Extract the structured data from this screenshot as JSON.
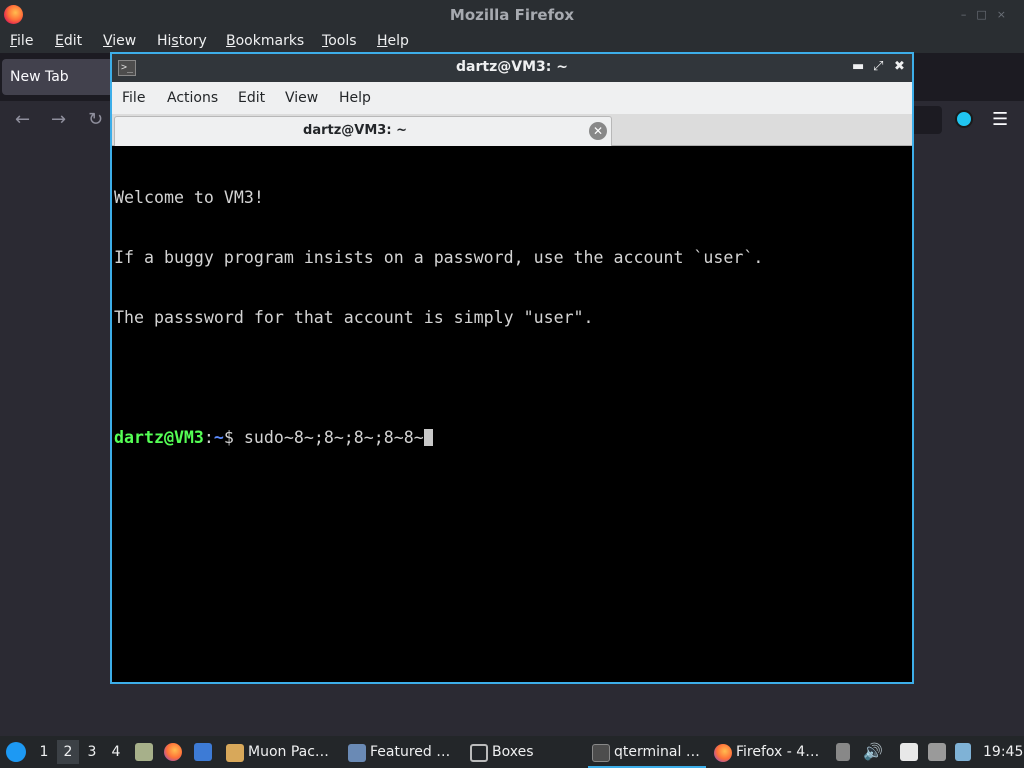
{
  "firefox": {
    "window_title": "Mozilla Firefox",
    "menu": [
      {
        "label": "File",
        "u": "F",
        "rest": "ile"
      },
      {
        "label": "Edit",
        "u": "E",
        "rest": "dit"
      },
      {
        "label": "View",
        "u": "V",
        "rest": "iew"
      },
      {
        "label": "History",
        "pre": "Hi",
        "u": "s",
        "rest": "tory"
      },
      {
        "label": "Bookmarks",
        "u": "B",
        "rest": "ookmarks"
      },
      {
        "label": "Tools",
        "u": "T",
        "rest": "ools"
      },
      {
        "label": "Help",
        "u": "H",
        "rest": "elp"
      }
    ],
    "tab_label": "New Tab",
    "nav": {
      "back_icon": "←",
      "forward_icon": "→",
      "reload_icon": "↻",
      "menu_icon": "☰"
    }
  },
  "terminal": {
    "window_title": "dartz@VM3: ~",
    "window_controls": {
      "minimize": "▬",
      "maximize": "⤢",
      "close": "✖"
    },
    "menu": [
      "File",
      "Actions",
      "Edit",
      "View",
      "Help"
    ],
    "tab_label": "dartz@VM3: ~",
    "tab_close": "✕",
    "output_lines": [
      "Welcome to VM3!",
      "If a buggy program insists on a password, use the account `user`.",
      "The passsword for that account is simply \"user\".",
      ""
    ],
    "prompt": {
      "user_host": "dartz@VM3",
      "colon": ":",
      "path": "~",
      "symbol": "$ "
    },
    "command": "sudo~8~;8~;8~;8~8~"
  },
  "taskbar": {
    "desktops": [
      "1",
      "2",
      "3",
      "4"
    ],
    "active_desktop": "2",
    "tasks": [
      {
        "label": "Muon Pac…",
        "icon": "muon-package-icon",
        "color": "#d8a85a"
      },
      {
        "label": "Featured …",
        "icon": "discover-icon",
        "color": "#6a8ab5"
      },
      {
        "label": "Boxes",
        "icon": "boxes-icon",
        "color": "#888888"
      },
      {
        "label": "qterminal …",
        "icon": "terminal-icon",
        "color": "#4d4d4d"
      },
      {
        "label": "Firefox - 4…",
        "icon": "firefox-icon",
        "color": "#ff7139"
      }
    ],
    "clock": "19:45"
  },
  "colors": {
    "accent": "#3daee9",
    "prompt_user": "#55ff55",
    "prompt_path": "#5c8cff"
  }
}
